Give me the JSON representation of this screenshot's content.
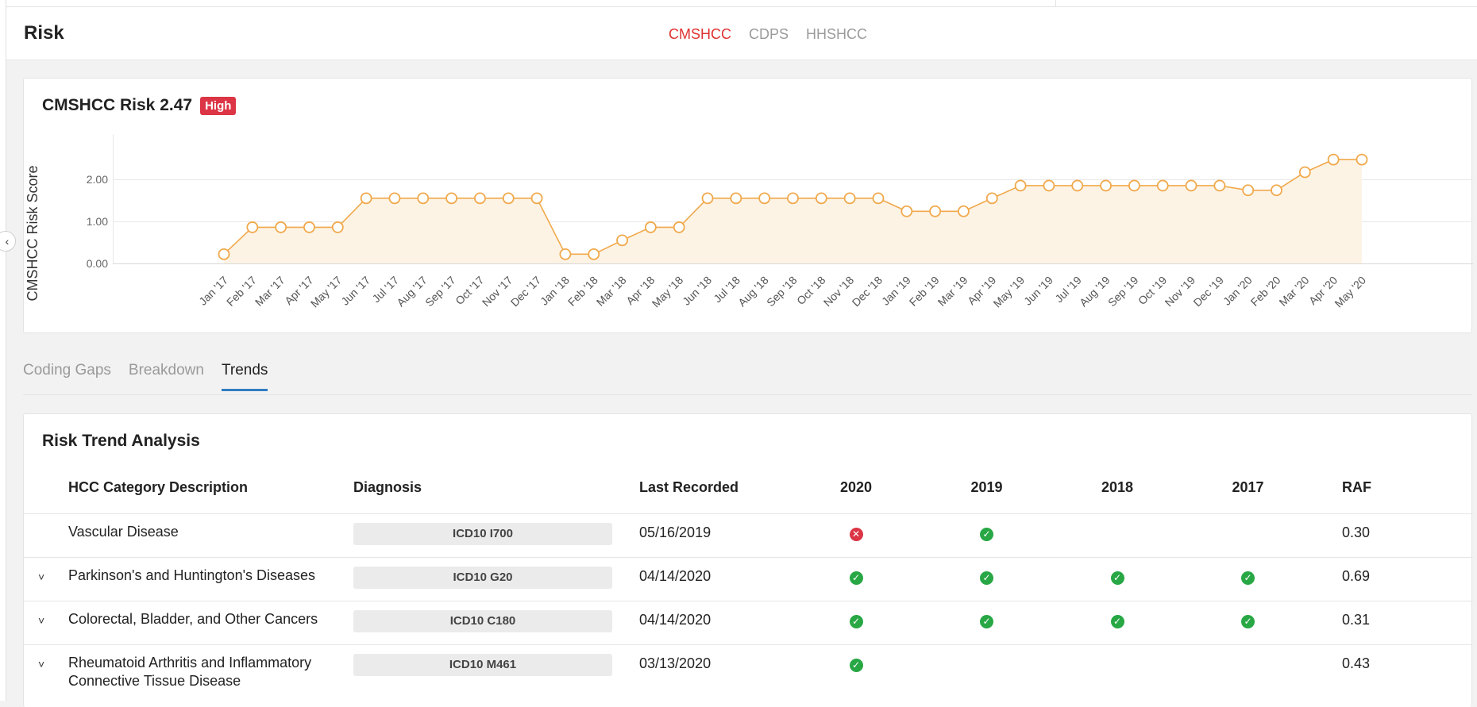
{
  "header": {
    "title": "Risk",
    "tabs": [
      {
        "label": "CMSHCC",
        "active": true
      },
      {
        "label": "CDPS",
        "active": false
      },
      {
        "label": "HHSHCC",
        "active": false
      }
    ]
  },
  "summary": {
    "title": "CMSHCC Risk 2.47",
    "badge": "High"
  },
  "subtabs": [
    {
      "label": "Coding Gaps",
      "active": false
    },
    {
      "label": "Breakdown",
      "active": false
    },
    {
      "label": "Trends",
      "active": true
    }
  ],
  "colors": {
    "accent": "#e03131",
    "badge": "#dc3545",
    "line": "#f0a94c",
    "area": "#fdf3e5",
    "tab_underline": "#2f7dc1",
    "check": "#28a745"
  },
  "chart_data": {
    "type": "line",
    "ylabel": "CMSHCC Risk Score",
    "xlabel": "",
    "ylim": [
      0,
      2.4
    ],
    "yticks": [
      "0.00",
      "1.00",
      "2.00"
    ],
    "grid": true,
    "area_fill": true,
    "x": [
      "Jan '17",
      "Feb '17",
      "Mar '17",
      "Apr '17",
      "May '17",
      "Jun '17",
      "Jul '17",
      "Aug '17",
      "Sep '17",
      "Oct '17",
      "Nov '17",
      "Dec '17",
      "Jan '18",
      "Feb '18",
      "Mar '18",
      "Apr '18",
      "May '18",
      "Jun '18",
      "Jul '18",
      "Aug '18",
      "Sep '18",
      "Oct '18",
      "Nov '18",
      "Dec '18",
      "Jan '19",
      "Feb '19",
      "Mar '19",
      "Apr '19",
      "May '19",
      "Jun '19",
      "Jul '19",
      "Aug '19",
      "Sep '19",
      "Oct '19",
      "Nov '19",
      "Dec '19",
      "Jan '20",
      "Feb '20",
      "Mar '20",
      "Apr '20",
      "May '20"
    ],
    "series": [
      {
        "values": [
          0.22,
          0.86,
          0.86,
          0.86,
          0.86,
          1.55,
          1.55,
          1.55,
          1.55,
          1.55,
          1.55,
          1.55,
          0.22,
          0.22,
          0.55,
          0.86,
          0.86,
          1.55,
          1.55,
          1.55,
          1.55,
          1.55,
          1.55,
          1.55,
          1.24,
          1.24,
          1.24,
          1.55,
          1.85,
          1.85,
          1.85,
          1.85,
          1.85,
          1.85,
          1.85,
          1.85,
          1.74,
          1.74,
          2.17,
          2.47,
          2.47
        ]
      }
    ]
  },
  "trend": {
    "title": "Risk Trend Analysis",
    "columns": [
      "HCC Category Description",
      "Diagnosis",
      "Last Recorded",
      "2020",
      "2019",
      "2018",
      "2017",
      "RAF"
    ],
    "rows": [
      {
        "expand": "",
        "category": "Vascular Disease",
        "diagnosis": "ICD10 I700",
        "last_recorded": "05/16/2019",
        "y2020": "bad",
        "y2019": "ok",
        "y2018": "",
        "y2017": "",
        "raf": "0.30"
      },
      {
        "expand": "˅",
        "category": "Parkinson's and Huntington's Diseases",
        "diagnosis": "ICD10 G20",
        "last_recorded": "04/14/2020",
        "y2020": "ok",
        "y2019": "ok",
        "y2018": "ok",
        "y2017": "ok",
        "raf": "0.69"
      },
      {
        "expand": "˅",
        "category": "Colorectal, Bladder, and Other Cancers",
        "diagnosis": "ICD10 C180",
        "last_recorded": "04/14/2020",
        "y2020": "ok",
        "y2019": "ok",
        "y2018": "ok",
        "y2017": "ok",
        "raf": "0.31"
      },
      {
        "expand": "˅",
        "category": "Rheumatoid Arthritis and Inflammatory Connective Tissue Disease",
        "diagnosis": "ICD10 M461",
        "last_recorded": "03/13/2020",
        "y2020": "ok",
        "y2019": "",
        "y2018": "",
        "y2017": "",
        "raf": "0.43"
      }
    ]
  }
}
